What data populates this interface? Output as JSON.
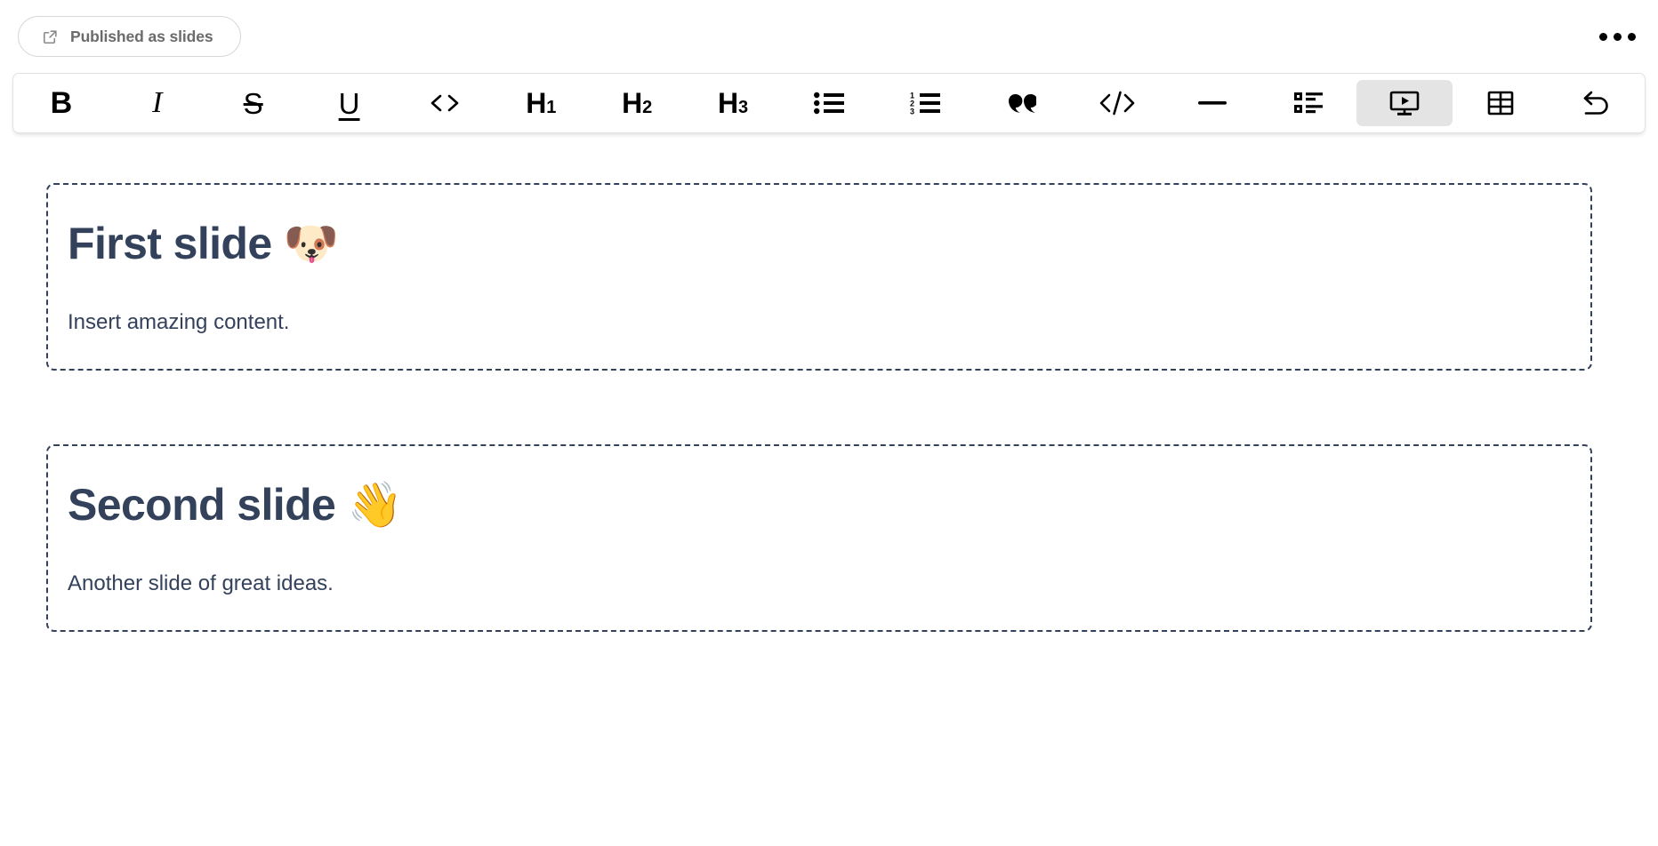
{
  "header": {
    "published_button": {
      "label": "Published as slides",
      "icon": "external-link-icon"
    },
    "more_menu": {
      "icon": "ellipsis-horizontal-icon",
      "label": "•••"
    }
  },
  "toolbar": {
    "items": [
      {
        "name": "bold",
        "label": "B",
        "icon": "bold-icon",
        "active": false
      },
      {
        "name": "italic",
        "label": "I",
        "icon": "italic-icon",
        "active": false
      },
      {
        "name": "strikethrough",
        "label": "S",
        "icon": "strikethrough-icon",
        "active": false
      },
      {
        "name": "underline",
        "label": "U",
        "icon": "underline-icon",
        "active": false
      },
      {
        "name": "inline-code",
        "label": "<>",
        "icon": "inline-code-icon",
        "active": false
      },
      {
        "name": "heading-1",
        "label": "H",
        "sub": "1",
        "icon": "heading-1-icon",
        "active": false
      },
      {
        "name": "heading-2",
        "label": "H",
        "sub": "2",
        "icon": "heading-2-icon",
        "active": false
      },
      {
        "name": "heading-3",
        "label": "H",
        "sub": "3",
        "icon": "heading-3-icon",
        "active": false
      },
      {
        "name": "bullet-list",
        "label": "",
        "icon": "bullet-list-icon",
        "active": false
      },
      {
        "name": "ordered-list",
        "label": "",
        "icon": "ordered-list-icon",
        "active": false
      },
      {
        "name": "blockquote",
        "label": "”",
        "icon": "blockquote-icon",
        "active": false
      },
      {
        "name": "code-block",
        "label": "</>",
        "icon": "code-block-icon",
        "active": false
      },
      {
        "name": "horizontal-rule",
        "label": "—",
        "icon": "horizontal-rule-icon",
        "active": false
      },
      {
        "name": "details-list",
        "label": "",
        "icon": "details-list-icon",
        "active": false
      },
      {
        "name": "slides",
        "label": "",
        "icon": "presentation-icon",
        "active": true
      },
      {
        "name": "table",
        "label": "",
        "icon": "table-icon",
        "active": false
      },
      {
        "name": "undo",
        "label": "",
        "icon": "undo-icon",
        "active": false
      }
    ]
  },
  "slides": [
    {
      "title": "First slide 🐶",
      "body": "Insert amazing content."
    },
    {
      "title": "Second slide 👋",
      "body": "Another slide of great ideas."
    }
  ],
  "colors": {
    "text": "#33415b",
    "slide_border": "#33415b",
    "toolbar_border": "#e2e2e2",
    "active_bg": "#e4e4e4",
    "pill_text": "#6b6b6b"
  }
}
